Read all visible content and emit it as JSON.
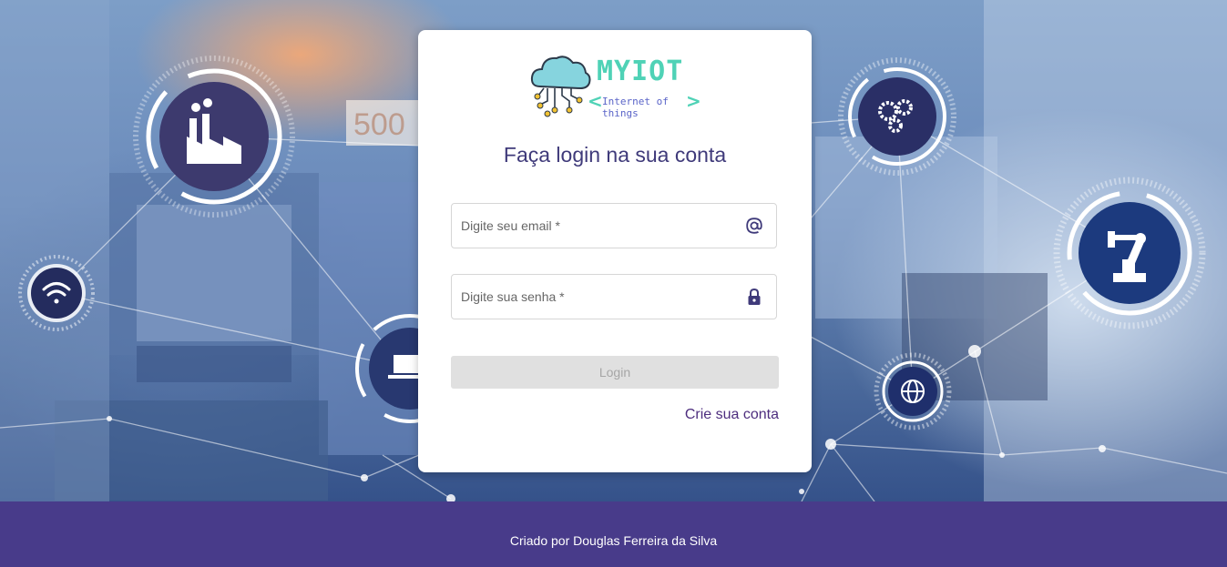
{
  "background": {
    "description_icons": [
      "factory-icon",
      "wifi-icon",
      "laptop-icon",
      "gears-icon",
      "robot-arm-icon",
      "globe-icon"
    ],
    "number_text": "500"
  },
  "logo": {
    "brand": "MYIOT",
    "tagline": "Internet of things",
    "chevron_left": "<",
    "chevron_right": ">"
  },
  "login": {
    "title": "Faça login na sua conta",
    "email_placeholder": "Digite seu email *",
    "password_placeholder": "Digite sua senha *",
    "login_label": "Login",
    "signup_label": "Crie sua conta"
  },
  "footer": {
    "text": "Criado por Douglas Ferreira da Silva"
  },
  "colors": {
    "accent": "#3f3a7a",
    "footer_bg": "#483b8a",
    "logo_green": "#4fd2b6",
    "logo_blue": "#5a64c8",
    "button_disabled": "#e0e0e0",
    "link": "#4d2d7e"
  }
}
